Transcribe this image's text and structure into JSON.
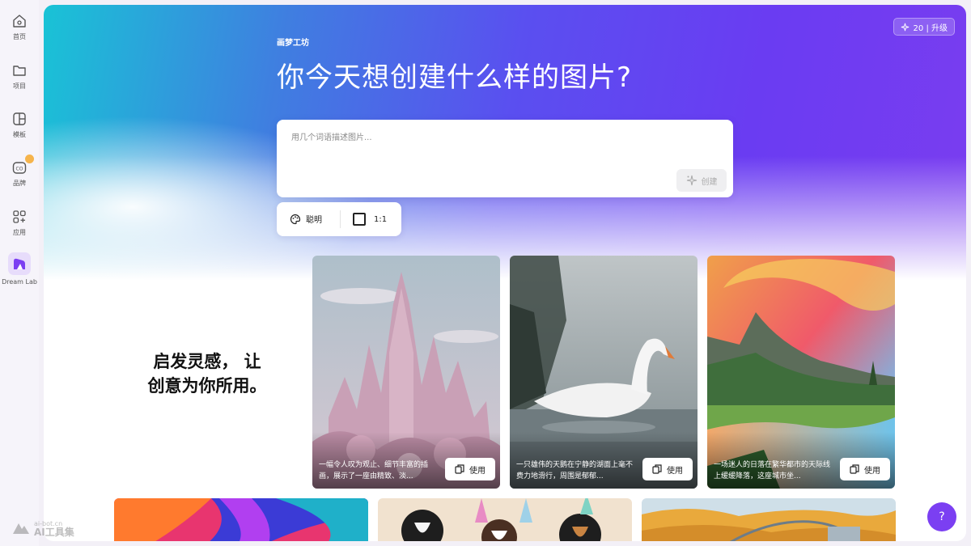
{
  "sidebar": {
    "items": [
      {
        "label": "首页",
        "icon": "home-icon"
      },
      {
        "label": "项目",
        "icon": "folder-icon"
      },
      {
        "label": "模板",
        "icon": "template-icon"
      },
      {
        "label": "品牌",
        "icon": "brand-icon"
      },
      {
        "label": "应用",
        "icon": "apps-icon"
      },
      {
        "label": "Dream Lab",
        "icon": "dream-lab-icon"
      }
    ]
  },
  "header": {
    "brand": "画梦工坊",
    "title": "你今天想创建什么样的图片?",
    "upgrade_label": "20 | 升级"
  },
  "prompt": {
    "placeholder": "用几个词语描述图片...",
    "value": "",
    "create_label": "创建"
  },
  "options": {
    "style_label": "聪明",
    "ratio_label": "1:1"
  },
  "inspiration": {
    "line1": "启发灵感， 让",
    "line2": "创意为你所用。"
  },
  "cards": [
    {
      "caption": "一幅令人叹为观止、细节丰富的插画，展示了一座由精致、淡...",
      "use_label": "使用"
    },
    {
      "caption": "一只雄伟的天鹅在宁静的湖面上毫不费力地滑行，周围是郁郁...",
      "use_label": "使用"
    },
    {
      "caption": "一场迷人的日落在繁华都市的天际线上缓缓降落，这座城市坐...",
      "use_label": "使用"
    }
  ],
  "help_label": "?",
  "watermark": {
    "small": "ai-bot.cn",
    "big": "AI工具集"
  },
  "colors": {
    "accent": "#7b3ff2",
    "hero_start": "#19c3d6",
    "hero_end": "#7a3df0"
  }
}
